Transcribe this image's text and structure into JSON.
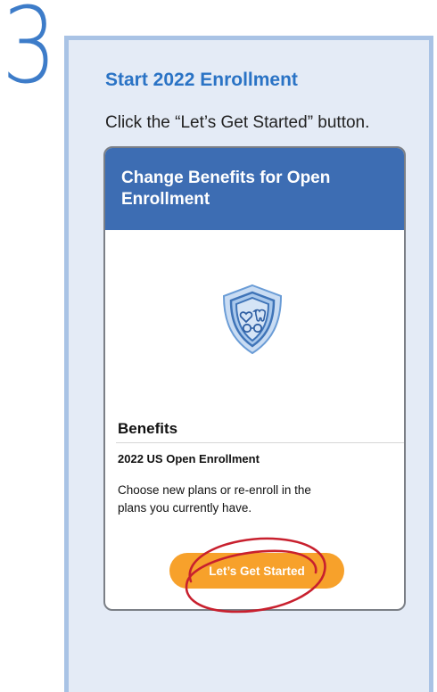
{
  "step": {
    "number": "3",
    "title": "Start 2022 Enrollment",
    "instruction": "Click the “Let’s Get Started” button."
  },
  "card": {
    "header_title": "Change Benefits for Open Enrollment",
    "icon": "benefits-shield-icon",
    "section_title": "Benefits",
    "enrollment_name": "2022 US Open Enrollment",
    "description": "Choose new plans or re-enroll in the plans you currently have.",
    "button_label": "Let’s Get Started"
  },
  "colors": {
    "step_number": "#3d7cc9",
    "panel_bg": "#e4ebf6",
    "panel_border": "#a9c3e5",
    "title_blue": "#2a73c5",
    "header_bg": "#3d6db3",
    "button_bg": "#f7a12b",
    "annotation_circle": "#c8202e"
  }
}
